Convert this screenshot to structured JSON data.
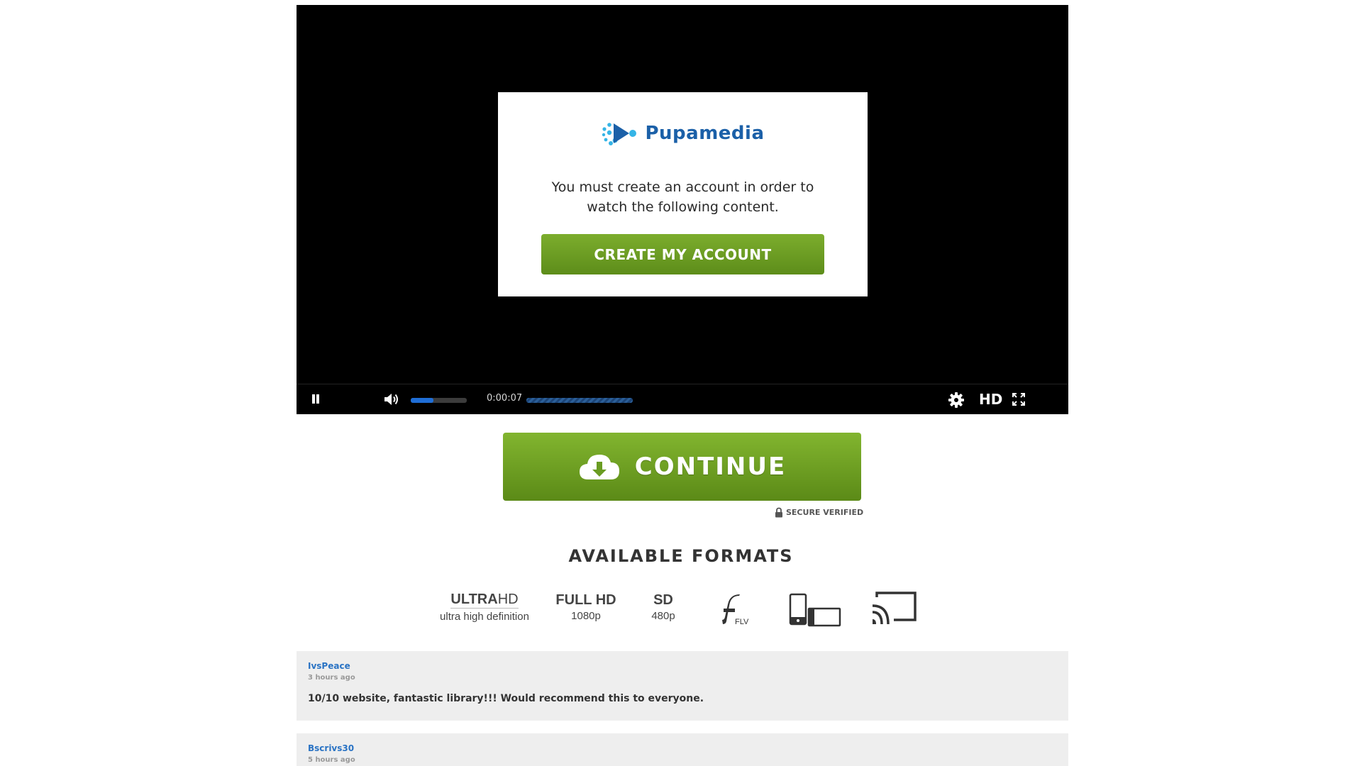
{
  "player": {
    "modal": {
      "brand_name": "Pupamedia",
      "message": "You must create an account in order to watch the following content.",
      "cta_label": "CREATE MY ACCOUNT"
    },
    "controls": {
      "pause_icon": "pause-icon",
      "volume_icon": "speaker-icon",
      "volume_level": 0.4,
      "time": "0:00:07",
      "settings_icon": "gear-icon",
      "quality_label": "HD",
      "fullscreen_icon": "fullscreen-icon"
    }
  },
  "download": {
    "button_label": "CONTINUE",
    "button_icon": "cloud-download-icon",
    "secure_label": "SECURE VERIFIED"
  },
  "formats": {
    "heading": "AVAILABLE FORMATS",
    "items": [
      {
        "title_bold": "ULTRA",
        "title_thin": "HD",
        "subtitle": "ultra high definition"
      },
      {
        "title": "FULL HD",
        "subtitle": "1080p"
      },
      {
        "title": "SD",
        "subtitle": "480p"
      },
      {
        "icon": "flash-icon",
        "label": "FLV"
      },
      {
        "icon": "devices-icon"
      },
      {
        "icon": "cast-icon"
      }
    ]
  },
  "comments": [
    {
      "user": "IvsPeace",
      "time": "3 hours ago",
      "text": "10/10 website, fantastic library!!! Would recommend this to everyone."
    },
    {
      "user": "Bscrivs30",
      "time": "5 hours ago",
      "text": ""
    }
  ],
  "colors": {
    "brand": "#1b60a8",
    "accent_green": "#6a9c22",
    "progress_blue": "#1f6ed6"
  }
}
